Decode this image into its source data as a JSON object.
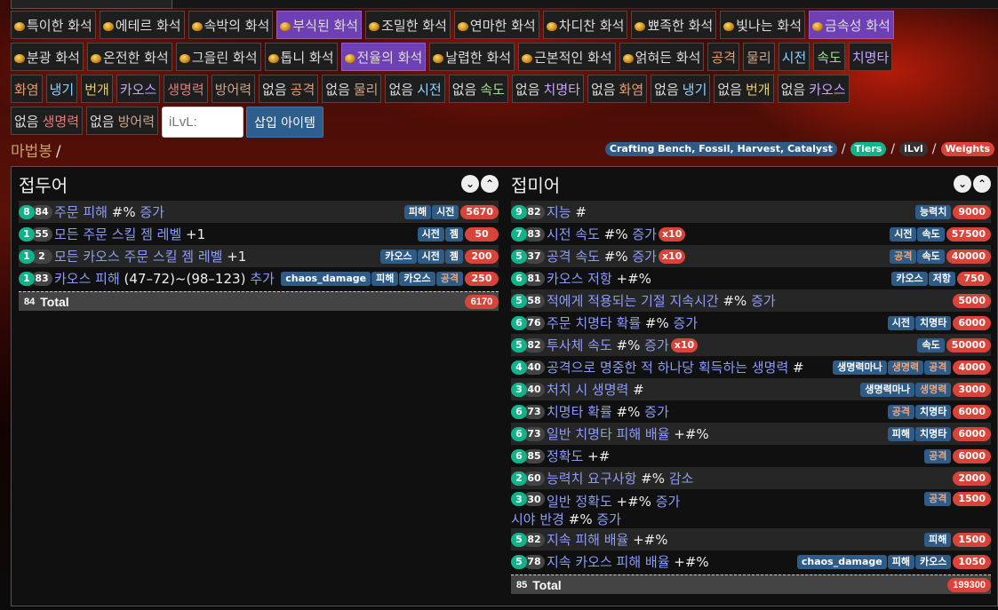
{
  "fossils_row1": [
    "특이한 화석",
    "에테르 화석",
    "속박의 화석",
    "부식된 화석",
    "조밀한 화석",
    "연마한 화석",
    "차디찬 화석",
    "뾰족한 화석",
    "빛나는 화석",
    "금속성 화석"
  ],
  "fossils_row2": [
    "분광 화석",
    "온전한 화석",
    "그을린 화석",
    "톱니 화석",
    "전율의 화석",
    "날렵한 화석",
    "근본적인 화석",
    "얽혀든 화석"
  ],
  "tags_row2": [
    "공격",
    "물리",
    "시전",
    "속도",
    "치명타"
  ],
  "tags_row3": [
    "화염",
    "냉기",
    "번개",
    "카오스",
    "생명력",
    "방어력"
  ],
  "none_prefix": "없음",
  "none_tags": [
    "공격",
    "물리",
    "시전",
    "속도",
    "치명타",
    "화염",
    "냉기",
    "번개",
    "카오스",
    "생명력",
    "방어력"
  ],
  "ilvl_placeholder": "iLvL:",
  "insert_label": "삽입 아이템",
  "crumb_base": "마법봉",
  "crumb_slash": "/",
  "filters": {
    "crafting": "Crafting Bench, Fossil, Harvest, Catalyst",
    "tiers": "Tiers",
    "ilvl": "iLvl",
    "weights": "Weights",
    "sep": "/"
  },
  "prefix": {
    "title": "접두어",
    "mods": [
      {
        "count": "8",
        "level": "84",
        "pre": "주문 피해 ",
        "val": "#%",
        "post": " 증가",
        "tags": [
          "피해",
          "시전"
        ],
        "weight": "5670"
      },
      {
        "count": "1",
        "level": "55",
        "pre": "모든 주문 스킬 젬 레벨 ",
        "val": "+1",
        "post": "",
        "tags": [
          "시전",
          "젬"
        ],
        "weight": "50"
      },
      {
        "count": "1",
        "level": "2",
        "pre": "모든 카오스 주문 스킬 젬 레벨 ",
        "val": "+1",
        "post": "",
        "tags": [
          "카오스",
          "시전",
          "젬"
        ],
        "weight": "200"
      },
      {
        "count": "1",
        "level": "83",
        "pre": "카오스 피해 ",
        "val": "(47–72)~(98–123)",
        "post": " 추가",
        "tags": [
          "chaos_damage",
          "피해",
          "카오스",
          "공격"
        ],
        "weight": "250"
      }
    ],
    "total_level": "84",
    "total_label": "Total",
    "total_weight": "6170"
  },
  "suffix": {
    "title": "접미어",
    "mods": [
      {
        "count": "9",
        "level": "82",
        "pre": "지능 ",
        "val": "#",
        "post": "",
        "tags": [
          "능력치"
        ],
        "weight": "9000"
      },
      {
        "count": "7",
        "level": "83",
        "pre": "시전 속도 ",
        "val": "#%",
        "post": " 증가",
        "x10": "x10",
        "tags": [
          "시전",
          "속도"
        ],
        "weight": "57500"
      },
      {
        "count": "5",
        "level": "37",
        "pre": "공격 속도 ",
        "val": "#%",
        "post": " 증가",
        "x10": "x10",
        "tags": [
          "공격",
          "속도"
        ],
        "weight": "40000"
      },
      {
        "count": "6",
        "level": "81",
        "pre": "카오스 저항 ",
        "val": "+#%",
        "post": "",
        "tags": [
          "카오스",
          "저항"
        ],
        "weight": "750"
      },
      {
        "count": "5",
        "level": "58",
        "pre": "적에게 적용되는 기절 지속시간 ",
        "val": "#%",
        "post": " 증가",
        "tags": [],
        "weight": "5000"
      },
      {
        "count": "6",
        "level": "76",
        "pre": "주문 치명타 확률 ",
        "val": "#%",
        "post": " 증가",
        "tags": [
          "시전",
          "치명타"
        ],
        "weight": "6000"
      },
      {
        "count": "5",
        "level": "82",
        "pre": "투사체 속도 ",
        "val": "#%",
        "post": " 증가",
        "x10": "x10",
        "tags": [
          "속도"
        ],
        "weight": "50000"
      },
      {
        "count": "4",
        "level": "40",
        "pre": "공격으로 명중한 적 하나당 획득하는 생명력 ",
        "val": "#",
        "post": "",
        "tags": [
          "생명력마나",
          "생명력",
          "공격"
        ],
        "weight": "4000"
      },
      {
        "count": "3",
        "level": "40",
        "pre": "처치 시 생명력 ",
        "val": "#",
        "post": "",
        "tags": [
          "생명력마나",
          "생명력"
        ],
        "weight": "3000"
      },
      {
        "count": "6",
        "level": "73",
        "pre": "치명타 확률 ",
        "val": "#%",
        "post": " 증가",
        "tags": [
          "공격",
          "치명타"
        ],
        "weight": "6000"
      },
      {
        "count": "6",
        "level": "73",
        "pre": "일반 치명타 피해 배율 ",
        "val": "+#%",
        "post": "",
        "tags": [
          "피해",
          "치명타"
        ],
        "weight": "6000"
      },
      {
        "count": "6",
        "level": "85",
        "pre": "정확도 ",
        "val": "+#",
        "post": "",
        "tags": [
          "공격"
        ],
        "weight": "6000"
      },
      {
        "count": "2",
        "level": "60",
        "pre": "능력치 요구사항 ",
        "val": "#%",
        "post": " 감소",
        "tags": [],
        "weight": "2000"
      },
      {
        "count": "3",
        "level": "30",
        "pre": "일반 정확도 ",
        "val": "+#%",
        "post": " 증가",
        "line2_pre": "시야 반경 ",
        "line2_val": "#%",
        "line2_post": " 증가",
        "tags": [
          "공격"
        ],
        "weight": "1500"
      },
      {
        "count": "5",
        "level": "82",
        "pre": "지속 피해 배율 ",
        "val": "+#%",
        "post": "",
        "tags": [
          "피해"
        ],
        "weight": "1500"
      },
      {
        "count": "5",
        "level": "78",
        "pre": "지속 카오스 피해 배율 ",
        "val": "+#%",
        "post": "",
        "tags": [
          "chaos_damage",
          "피해",
          "카오스"
        ],
        "weight": "1050"
      }
    ],
    "total_level": "85",
    "total_label": "Total",
    "total_weight": "199300"
  }
}
